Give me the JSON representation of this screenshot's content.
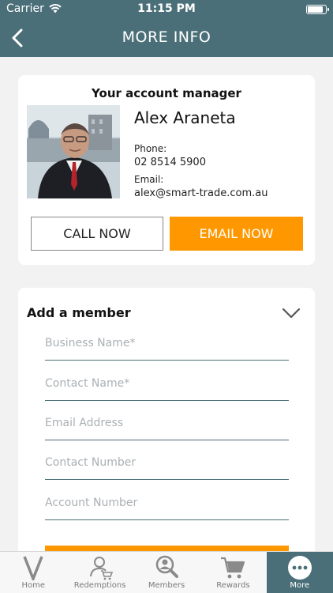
{
  "status_bar": {
    "carrier": "Carrier",
    "time": "11:15 PM"
  },
  "nav": {
    "title": "MORE INFO",
    "back_icon": "chevron-left-icon"
  },
  "manager": {
    "heading": "Your account manager",
    "name": "Alex Araneta",
    "phone_label": "Phone:",
    "phone": "02 8514 5900",
    "email_label": "Email:",
    "email": "alex@smart-trade.com.au",
    "call_label": "CALL NOW",
    "email_button_label": "EMAIL NOW"
  },
  "add_member": {
    "heading": "Add a member",
    "fields": [
      {
        "placeholder": "Business Name*"
      },
      {
        "placeholder": "Contact Name*"
      },
      {
        "placeholder": "Email Address"
      },
      {
        "placeholder": "Contact Number"
      },
      {
        "placeholder": "Account Number"
      }
    ]
  },
  "tabs": [
    {
      "label": "Home",
      "icon": "home-v-icon"
    },
    {
      "label": "Redemptions",
      "icon": "redemptions-icon"
    },
    {
      "label": "Members",
      "icon": "members-search-icon"
    },
    {
      "label": "Rewards",
      "icon": "cart-icon"
    },
    {
      "label": "More",
      "icon": "more-dots-icon",
      "active": true
    }
  ],
  "colors": {
    "primary": "#4b6f78",
    "accent": "#ff9800"
  }
}
